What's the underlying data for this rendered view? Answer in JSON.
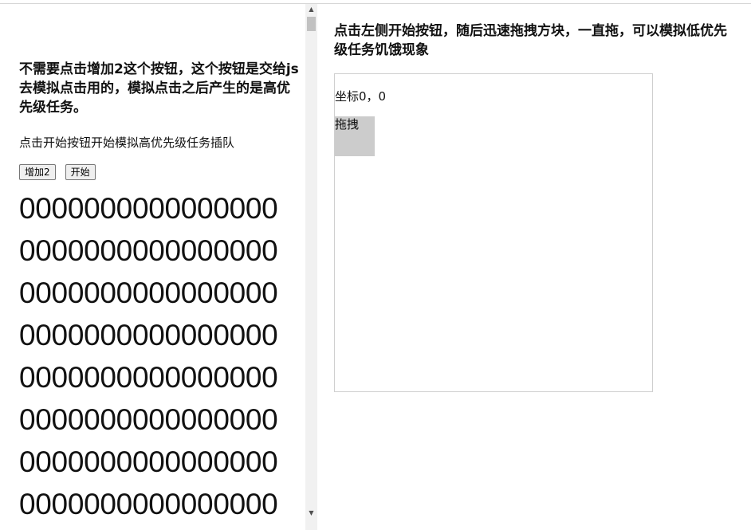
{
  "left": {
    "title": "不需要点击增加2这个按钮，这个按钮是交给js去模拟点击用的，模拟点击之后产生的是高优先级任务。",
    "description": "点击开始按钮开始模拟高优先级任务插队",
    "buttons": {
      "add2_label": "增加2",
      "start_label": "开始"
    },
    "lines": [
      "0000000000000000",
      "0000000000000000",
      "0000000000000000",
      "0000000000000000",
      "0000000000000000",
      "0000000000000000",
      "0000000000000000",
      "0000000000000000"
    ]
  },
  "scrollbar": {
    "up_arrow": "▲",
    "down_arrow": "▼"
  },
  "right": {
    "title": "点击左侧开始按钮，随后迅速拖拽方块，一直拖，可以模拟低优先级任务饥饿现象",
    "coords_label": "坐标0，0",
    "drag_label": "拖拽"
  }
}
